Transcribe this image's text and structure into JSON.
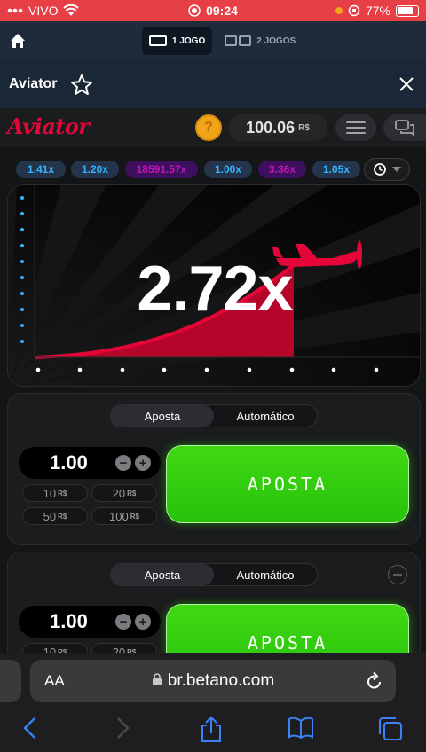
{
  "status": {
    "carrier": "VIVO",
    "time": "09:24",
    "battery": "77%"
  },
  "topnav": {
    "one_game": "1 JOGO",
    "two_games": "2 JOGOS"
  },
  "titlebar": {
    "title": "Aviator"
  },
  "aviator": {
    "logo": "Aviator",
    "coin_symbol": "?",
    "balance": "100.06",
    "currency": "R$"
  },
  "multipliers": [
    {
      "value": "1.41x",
      "color": "blue"
    },
    {
      "value": "1.20x",
      "color": "blue"
    },
    {
      "value": "18591.57x",
      "color": "purple"
    },
    {
      "value": "1.00x",
      "color": "blue"
    },
    {
      "value": "3.36x",
      "color": "purple"
    },
    {
      "value": "1.05x",
      "color": "blue"
    }
  ],
  "game": {
    "multiplier": "2.72x"
  },
  "bet_panel_1": {
    "tabs": [
      "Aposta",
      "Automático"
    ],
    "amount": "1.00",
    "quick": [
      {
        "n": "10",
        "c": "R$"
      },
      {
        "n": "20",
        "c": "R$"
      },
      {
        "n": "50",
        "c": "R$"
      },
      {
        "n": "100",
        "c": "R$"
      }
    ],
    "button": "APOSTA"
  },
  "bet_panel_2": {
    "tabs": [
      "Aposta",
      "Automático"
    ],
    "amount": "1.00",
    "quick": [
      {
        "n": "10",
        "c": "R$"
      },
      {
        "n": "20",
        "c": "R$"
      }
    ],
    "button": "APOSTA"
  },
  "browser": {
    "aa": "AA",
    "url": "br.betano.com"
  },
  "colors": {
    "accent_red": "#e50539",
    "bet_green": "#3fd913",
    "status_bar": "#e73f46"
  }
}
